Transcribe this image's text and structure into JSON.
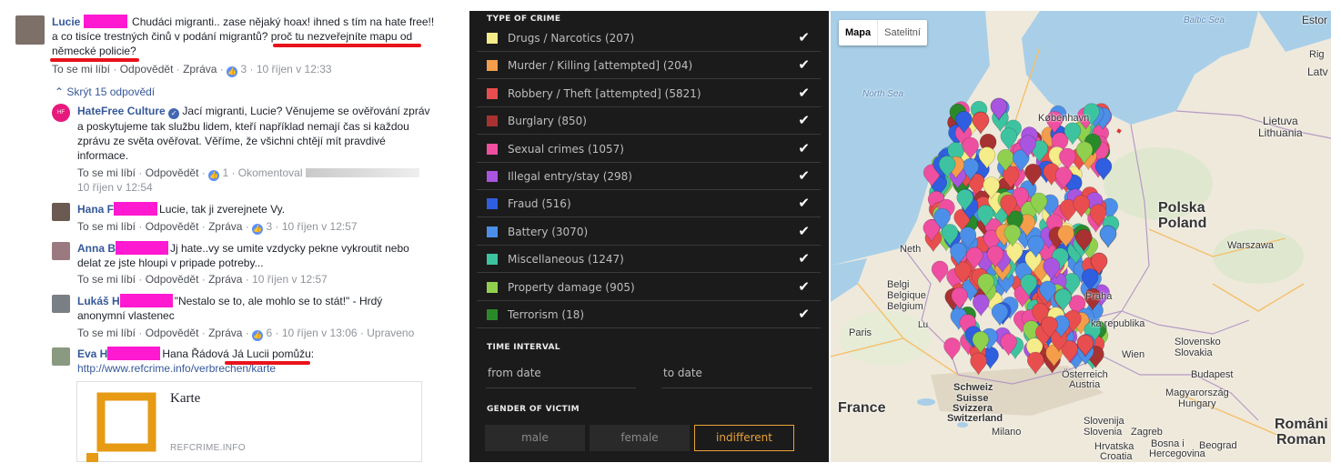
{
  "fb": {
    "c1": {
      "name": "Lucie",
      "text": "Chudáci migranti.. zase nějaký hoax! ihned s tím na hate free!! a co tisíce trestných činů v podání migrantů? proč tu nezveřejníte mapu od německé policie?",
      "like": "To se mi líbí",
      "reply": "Odpovědět",
      "report": "Zpráva",
      "count": "3",
      "time": "10 říjen v 12:33"
    },
    "hide_replies": "Skrýt 15 odpovědí",
    "c2": {
      "name": "HateFree Culture",
      "text": "Jací migranti, Lucie? Věnujeme se ověřování zpráv a poskytujeme tak službu lidem, kteří například nemají čas si každou zprávu ze světa ověřovat. Věříme, že všichni chtějí mít pravdivé informace.",
      "like": "To se mi líbí",
      "reply": "Odpovědět",
      "count": "1",
      "extra": "Okomentoval",
      "time": "10 říjen v 12:54"
    },
    "c3": {
      "name": "Hana F",
      "text": "Lucie, tak ji zverejnete Vy.",
      "like": "To se mi líbí",
      "reply": "Odpovědět",
      "report": "Zpráva",
      "count": "3",
      "time": "10 říjen v 12:57"
    },
    "c4": {
      "name": "Anna B",
      "text": "Jj hate..vy se umite vzdycky pekne vykroutit nebo delat ze jste hloupi v pripade potreby...",
      "like": "To se mi líbí",
      "reply": "Odpovědět",
      "report": "Zpráva",
      "time": "10 říjen v 12:57"
    },
    "c5": {
      "name": "Lukáš H",
      "text": "\"Nestalo se to, ale mohlo se to stát!\" - Hrdý anonymní vlastenec",
      "like": "To se mi líbí",
      "reply": "Odpovědět",
      "report": "Zpráva",
      "count": "6",
      "time": "10 říjen v 13:06",
      "edited": "Upraveno"
    },
    "c6": {
      "name": "Eva H",
      "tag": "Hana Řádová",
      "text": "Já Lucii pomůžu:",
      "url": "http://www.refcrime.info/verbrechen/karte"
    },
    "card": {
      "title": "Karte",
      "host": "REFCRIME.INFO"
    }
  },
  "panel": {
    "type_header": "TYPE OF CRIME",
    "crimes": [
      {
        "label": "Drugs / Narcotics (207)",
        "color": "#f5ec8a"
      },
      {
        "label": "Murder / Killing [attempted] (204)",
        "color": "#f49d4b"
      },
      {
        "label": "Robbery / Theft [attempted] (5821)",
        "color": "#e94e4e"
      },
      {
        "label": "Burglary (850)",
        "color": "#a83232"
      },
      {
        "label": "Sexual crimes (1057)",
        "color": "#ee4fa0"
      },
      {
        "label": "Illegal entry/stay (298)",
        "color": "#a955e0"
      },
      {
        "label": "Fraud (516)",
        "color": "#2f5ee0"
      },
      {
        "label": "Battery (3070)",
        "color": "#4c8fe8"
      },
      {
        "label": "Miscellaneous (1247)",
        "color": "#3ec3a0"
      },
      {
        "label": "Property damage (905)",
        "color": "#8fd14f"
      },
      {
        "label": "Terrorism (18)",
        "color": "#2a8a2a"
      }
    ],
    "check": "✔",
    "interval_header": "TIME INTERVAL",
    "from_date": "from date",
    "to_date": "to date",
    "gender_header": "GENDER OF VICTIM",
    "gender": [
      "male",
      "female",
      "indifferent"
    ]
  },
  "map": {
    "toggle": [
      "Mapa",
      "Satelitní"
    ],
    "labels": {
      "baltic": "Baltic Sea",
      "north": "North Sea",
      "kobenhavn": "København",
      "latvia": "Latv",
      "lietuva": "Lietuva",
      "lithuania": "Lithuania",
      "eston": "Estor",
      "rig": "Rig",
      "polska": "Polska",
      "poland": "Poland",
      "warszawa": "Warszawa",
      "neth": "Neth",
      "belg1": "Belgi",
      "belg2": "Belgique",
      "belg3": "Belgium",
      "lux": "Lu",
      "paris": "Paris",
      "praha": "Praha",
      "ceska": "ká republika",
      "slovensko": "Slovensko",
      "slovakia": "Slovakia",
      "wien": "Wien",
      "osterreich": "Österreich",
      "austria": "Austria",
      "schweiz": "Schweiz",
      "suisse": "Suisse",
      "svizzera": "Svizzera",
      "switzerland": "Switzerland",
      "france": "France",
      "magyar": "Magyarország",
      "hungary": "Hungary",
      "budapest": "Budapest",
      "milano": "Milano",
      "slovenija": "Slovenija",
      "slovenia": "Slovenia",
      "zagreb": "Zagreb",
      "hrvatska": "Hrvatska",
      "croatia": "Croatia",
      "bih": "Bosna i",
      "herceg": "Hercegovina",
      "beograd": "Beograd",
      "romania": "Români",
      "romania2": "Roman"
    }
  }
}
